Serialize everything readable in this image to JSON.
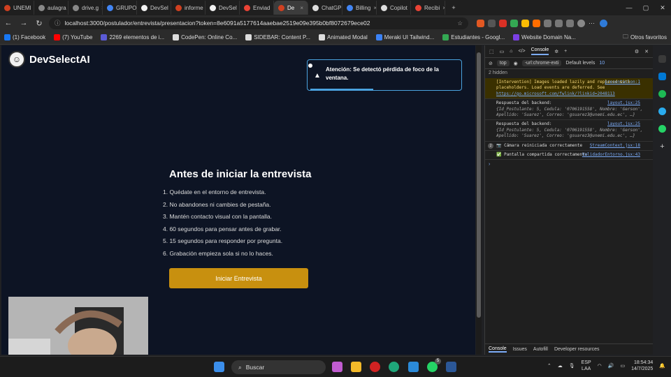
{
  "browser": {
    "tabs": [
      {
        "label": "UNEMI",
        "color": "#d04020",
        "active": false
      },
      {
        "label": "aulagra",
        "color": "#888888",
        "active": false
      },
      {
        "label": "drive.g",
        "color": "#888888",
        "active": false
      },
      {
        "label": "GRUPO",
        "color": "#4285f4",
        "active": false
      },
      {
        "label": "DevSel",
        "color": "#f2f2f2",
        "active": false
      },
      {
        "label": "informe",
        "color": "#d04020",
        "active": false
      },
      {
        "label": "DevSel",
        "color": "#f2f2f2",
        "active": false
      },
      {
        "label": "Enviad",
        "color": "#ea4335",
        "active": false
      },
      {
        "label": "De",
        "color": "#d04020",
        "active": true
      },
      {
        "label": "ChatGP",
        "color": "#dddddd",
        "active": false
      },
      {
        "label": "Billing",
        "color": "#4285f4",
        "active": false
      },
      {
        "label": "Copilot",
        "color": "#dddddd",
        "active": false
      },
      {
        "label": "Recibi",
        "color": "#ea4335",
        "active": false
      }
    ],
    "new_tab": "+",
    "url": "localhost:3000/postulador/entrevista/presentacion?token=8e6091a5177614aaebae2519e09e395b0bf8072679ece02",
    "bookmarks": [
      {
        "label": "(1) Facebook",
        "color": "#1877f2"
      },
      {
        "label": "(7) YouTube",
        "color": "#ff0000"
      },
      {
        "label": "2269 elementos de i...",
        "color": "#5b5bd6"
      },
      {
        "label": "CodePen: Online Co...",
        "color": "#dddddd"
      },
      {
        "label": "SIDEBAR: Content P...",
        "color": "#dddddd"
      },
      {
        "label": "Animated Modal",
        "color": "#dddddd"
      },
      {
        "label": "Meraki UI Tailwind...",
        "color": "#3b82f6"
      },
      {
        "label": "Estudiantes - Googl...",
        "color": "#34a853"
      },
      {
        "label": "Website Domain Na...",
        "color": "#7b3fe4"
      }
    ],
    "other_favorites": "Otros favoritos"
  },
  "page": {
    "brand": "DevSelectAI",
    "toast": "Atención: Se detectó pérdida de foco de la ventana.",
    "title": "Antes de iniciar la entrevista",
    "rules": [
      "1. Quédate en el entorno de entrevista.",
      "2. No abandones ni cambies de pestaña.",
      "3. Mantén contacto visual con la pantalla.",
      "4. 60 segundos para pensar antes de grabar.",
      "5. 15 segundos para responder por pregunta.",
      "6. Grabación empieza sola si no lo haces."
    ],
    "start_button": "Iniciar Entrevista"
  },
  "devtools": {
    "active_tab": "Console",
    "context": "top",
    "filter": "-url:chrome-exti",
    "levels": "Default levels",
    "issues_count": "10",
    "hidden": "2 hidden",
    "messages": [
      {
        "text": "[Intervention] Images loaded lazily and replaced with placeholders. Load events are deferred. See ",
        "link": "https://go.microsoft.com/fwlink/?linkid=2048113",
        "source": "presentacion:1"
      },
      {
        "text": "Respuesta del backend:",
        "detail": "{Id_Postulante: 5, Cedula: '0706191558', Nombre: 'Gerson', Apellido: 'Suarez', Correo: 'gsuarez3@unemi.edu.ec', …}",
        "source": "layout.jsx:25"
      },
      {
        "text": "Respuesta del backend:",
        "detail": "{Id_Postulante: 5, Cedula: '0706191558', Nombre: 'Gerson', Apellido: 'Suarez', Correo: 'gsuarez3@unemi.edu.ec', …}",
        "source": "layout.jsx:25"
      },
      {
        "count": "2",
        "text": "📷 Cámara reiniciada correctamente",
        "source": "StreamContext.jsx:18"
      },
      {
        "text": "✅ Pantalla compartida correctamente",
        "source": "ValidadorEntorno.jsx:43"
      }
    ],
    "bottom_tabs": [
      "Console",
      "Issues",
      "Autofill",
      "Developer resources"
    ]
  },
  "taskbar": {
    "search": "Buscar",
    "lang": "ESP",
    "lang2": "LAA",
    "time": "18:54:34",
    "date": "14/7/2025",
    "badge": "5"
  }
}
